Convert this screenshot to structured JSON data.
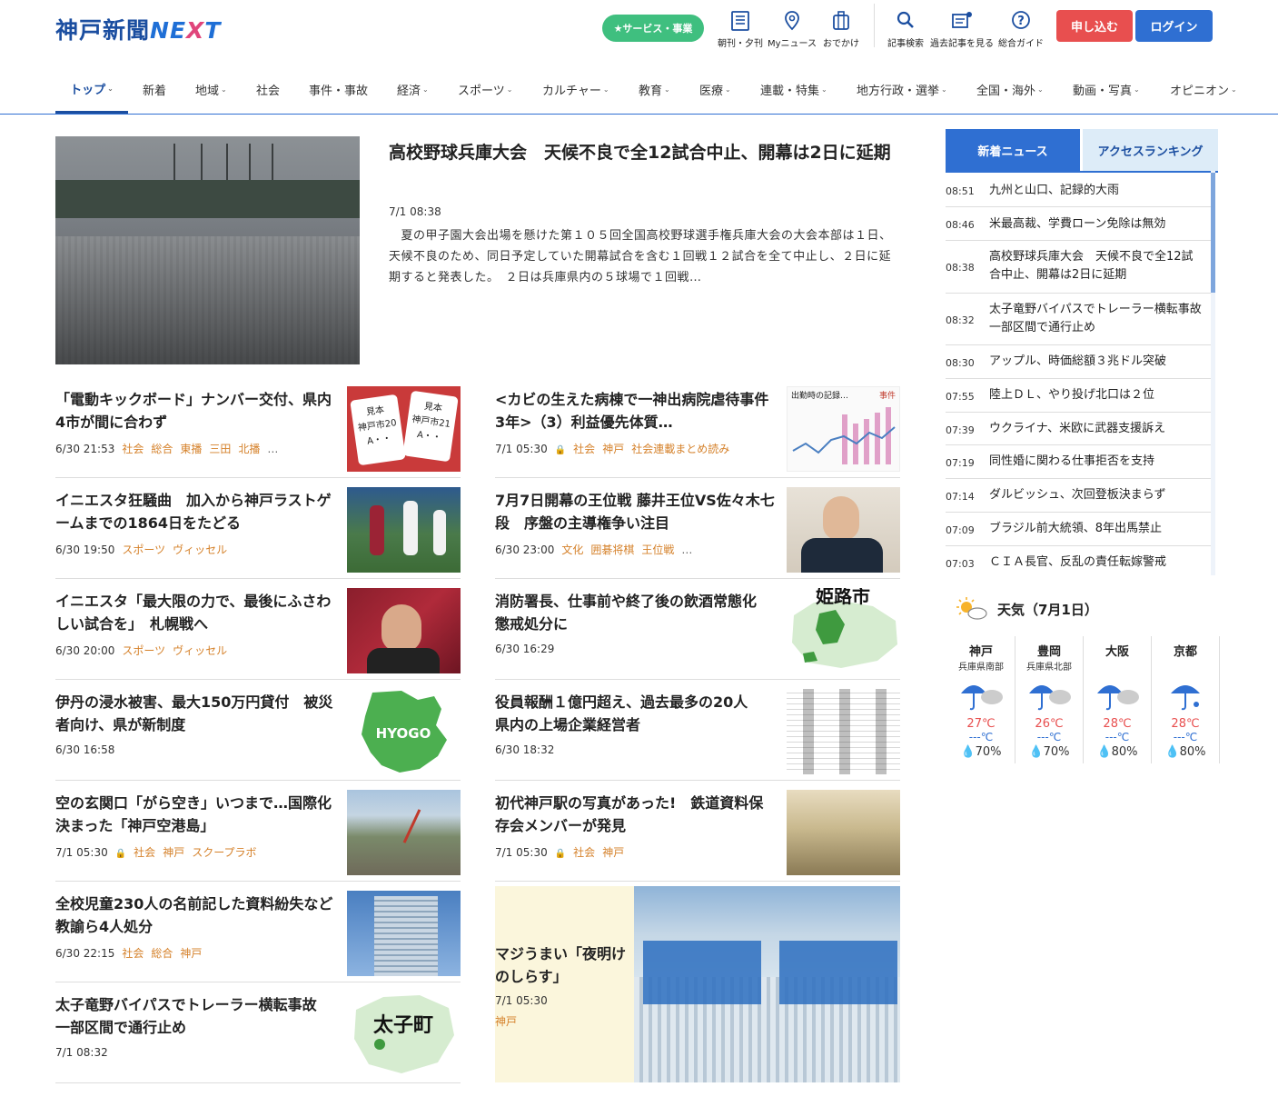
{
  "header": {
    "logo_main": "神戸新聞",
    "logo_next_a": "NE",
    "logo_next_x": "X",
    "logo_next_t": "T",
    "service_label": "★サービス・事業",
    "icons": [
      {
        "label": "朝刊・夕刊",
        "icon": "newspaper-icon"
      },
      {
        "label": "Myニュース",
        "icon": "pin-icon"
      },
      {
        "label": "おでかけ",
        "icon": "suitcase-icon"
      },
      {
        "label": "記事検索",
        "icon": "search-icon"
      },
      {
        "label": "過去記事を見る",
        "icon": "archive-icon"
      },
      {
        "label": "総合ガイド",
        "icon": "help-icon"
      }
    ],
    "apply_label": "申し込む",
    "login_label": "ログイン"
  },
  "nav": [
    {
      "label": "トップ",
      "chev": true
    },
    {
      "label": "新着",
      "chev": false
    },
    {
      "label": "地域",
      "chev": true
    },
    {
      "label": "社会",
      "chev": false
    },
    {
      "label": "事件・事故",
      "chev": false
    },
    {
      "label": "経済",
      "chev": true
    },
    {
      "label": "スポーツ",
      "chev": true
    },
    {
      "label": "カルチャー",
      "chev": true
    },
    {
      "label": "教育",
      "chev": true
    },
    {
      "label": "医療",
      "chev": true
    },
    {
      "label": "連載・特集",
      "chev": true
    },
    {
      "label": "地方行政・選挙",
      "chev": true
    },
    {
      "label": "全国・海外",
      "chev": true
    },
    {
      "label": "動画・写真",
      "chev": true
    },
    {
      "label": "オピニオン",
      "chev": true
    }
  ],
  "feature": {
    "title": "高校野球兵庫大会　天候不良で全12試合中止、開幕は2日に延期",
    "time": "7/1 08:38",
    "body": "　夏の甲子園大会出場を懸けた第１０５回全国高校野球選手権兵庫大会の大会本部は１日、天候不良のため、同日予定していた開幕試合を含む１回戦１２試合を全て中止し、２日に延期すると発表した。　２日は兵庫県内の５球場で１回戦…"
  },
  "articles_left": [
    {
      "title": "「電動キックボード」ナンバー交付、県内4市が間に合わず",
      "time": "6/30 21:53",
      "lock": false,
      "tags": [
        "社会",
        "総合",
        "東播",
        "三田",
        "北播",
        "…"
      ]
    },
    {
      "title": "イニエスタ狂騒曲　加入から神戸ラストゲームまでの1864日をたどる",
      "time": "6/30 19:50",
      "lock": false,
      "tags": [
        "スポーツ",
        "ヴィッセル"
      ]
    },
    {
      "title": "イニエスタ「最大限の力で、最後にふさわしい試合を」　札幌戦へ",
      "time": "6/30 20:00",
      "lock": false,
      "tags": [
        "スポーツ",
        "ヴィッセル"
      ]
    },
    {
      "title": "伊丹の浸水被害、最大150万円貸付　被災者向け、県が新制度",
      "time": "6/30 16:58",
      "lock": false,
      "tags": []
    },
    {
      "title": "空の玄関口「がら空き」いつまで…国際化決まった「神戸空港島」",
      "time": "7/1 05:30",
      "lock": true,
      "tags": [
        "社会",
        "神戸",
        "スクープラボ"
      ]
    },
    {
      "title": "全校児童230人の名前記した資料紛失など　教諭ら4人処分",
      "time": "6/30 22:15",
      "lock": false,
      "tags": [
        "社会",
        "総合",
        "神戸"
      ]
    },
    {
      "title": "太子竜野バイパスでトレーラー横転事故　一部区間で通行止め",
      "time": "7/1 08:32",
      "lock": false,
      "tags": []
    }
  ],
  "articles_right": [
    {
      "title": "<カビの生えた病棟で一神出病院虐待事件3年>（3）利益優先体質…",
      "time": "7/1 05:30",
      "lock": true,
      "tags": [
        "社会",
        "神戸",
        "社会連載まとめ読み"
      ]
    },
    {
      "title": "7月7日開幕の王位戦 藤井王位VS佐々木七段　序盤の主導権争い注目",
      "time": "6/30 23:00",
      "lock": false,
      "tags": [
        "文化",
        "囲碁将棋",
        "王位戦",
        "…"
      ]
    },
    {
      "title": "消防署長、仕事前や終了後の飲酒常態化　懲戒処分に",
      "time": "6/30 16:29",
      "lock": false,
      "tags": []
    },
    {
      "title": "役員報酬１億円超え、過去最多の20人　県内の上場企業経営者",
      "time": "6/30 18:32",
      "lock": false,
      "tags": []
    },
    {
      "title": "初代神戸駅の写真があった!　鉄道資料保存会メンバーが発見",
      "time": "7/1 05:30",
      "lock": true,
      "tags": [
        "社会",
        "神戸"
      ]
    }
  ],
  "thumb_text": {
    "kickboard_a": "見本\n神戸市20\nA・・",
    "kickboard_b": "見本\n神戸市21\nA・・",
    "hyogo": "HYOGO",
    "himeji": "姫路市",
    "taishi": "太子町",
    "chart_title": "出勤時の記録…",
    "chart_tag": "事件"
  },
  "yomei": {
    "title": "マジうまい「夜明けのしらす」",
    "time": "7/1 05:30",
    "tag": "神戸"
  },
  "sidebar": {
    "tab_new": "新着ニュース",
    "tab_rank": "アクセスランキング",
    "news": [
      {
        "time": "08:51",
        "headline": "九州と山口、記録的大雨"
      },
      {
        "time": "08:46",
        "headline": "米最高裁、学費ローン免除は無効"
      },
      {
        "time": "08:38",
        "headline": "高校野球兵庫大会　天候不良で全12試合中止、開幕は2日に延期"
      },
      {
        "time": "08:32",
        "headline": "太子竜野バイパスでトレーラー横転事故　一部区間で通行止め"
      },
      {
        "time": "08:30",
        "headline": "アップル、時価総額３兆ドル突破"
      },
      {
        "time": "07:55",
        "headline": "陸上ＤＬ、やり投げ北口は２位"
      },
      {
        "time": "07:39",
        "headline": "ウクライナ、米欧に武器支援訴え"
      },
      {
        "time": "07:19",
        "headline": "同性婚に関わる仕事拒否を支持"
      },
      {
        "time": "07:14",
        "headline": "ダルビッシュ、次回登板決まらず"
      },
      {
        "time": "07:09",
        "headline": "ブラジル前大統領、8年出馬禁止"
      },
      {
        "time": "07:03",
        "headline": "ＣＩＡ長官、反乱の責任転嫁警戒"
      }
    ]
  },
  "weather": {
    "title": "天気（7月1日）",
    "cities": [
      {
        "city": "神戸",
        "sub": "兵庫県南部",
        "hi": "27℃",
        "lo": "---℃",
        "rain": "70%"
      },
      {
        "city": "豊岡",
        "sub": "兵庫県北部",
        "hi": "26℃",
        "lo": "---℃",
        "rain": "70%"
      },
      {
        "city": "大阪",
        "sub": "",
        "hi": "28℃",
        "lo": "---℃",
        "rain": "80%"
      },
      {
        "city": "京都",
        "sub": "",
        "hi": "28℃",
        "lo": "---℃",
        "rain": "80%"
      }
    ]
  },
  "colors": {
    "brand": "#1b4ea0",
    "accent": "#2f6fd2",
    "tag": "#d5812a",
    "apply": "#e84f4f",
    "service": "#3fbf7f"
  }
}
